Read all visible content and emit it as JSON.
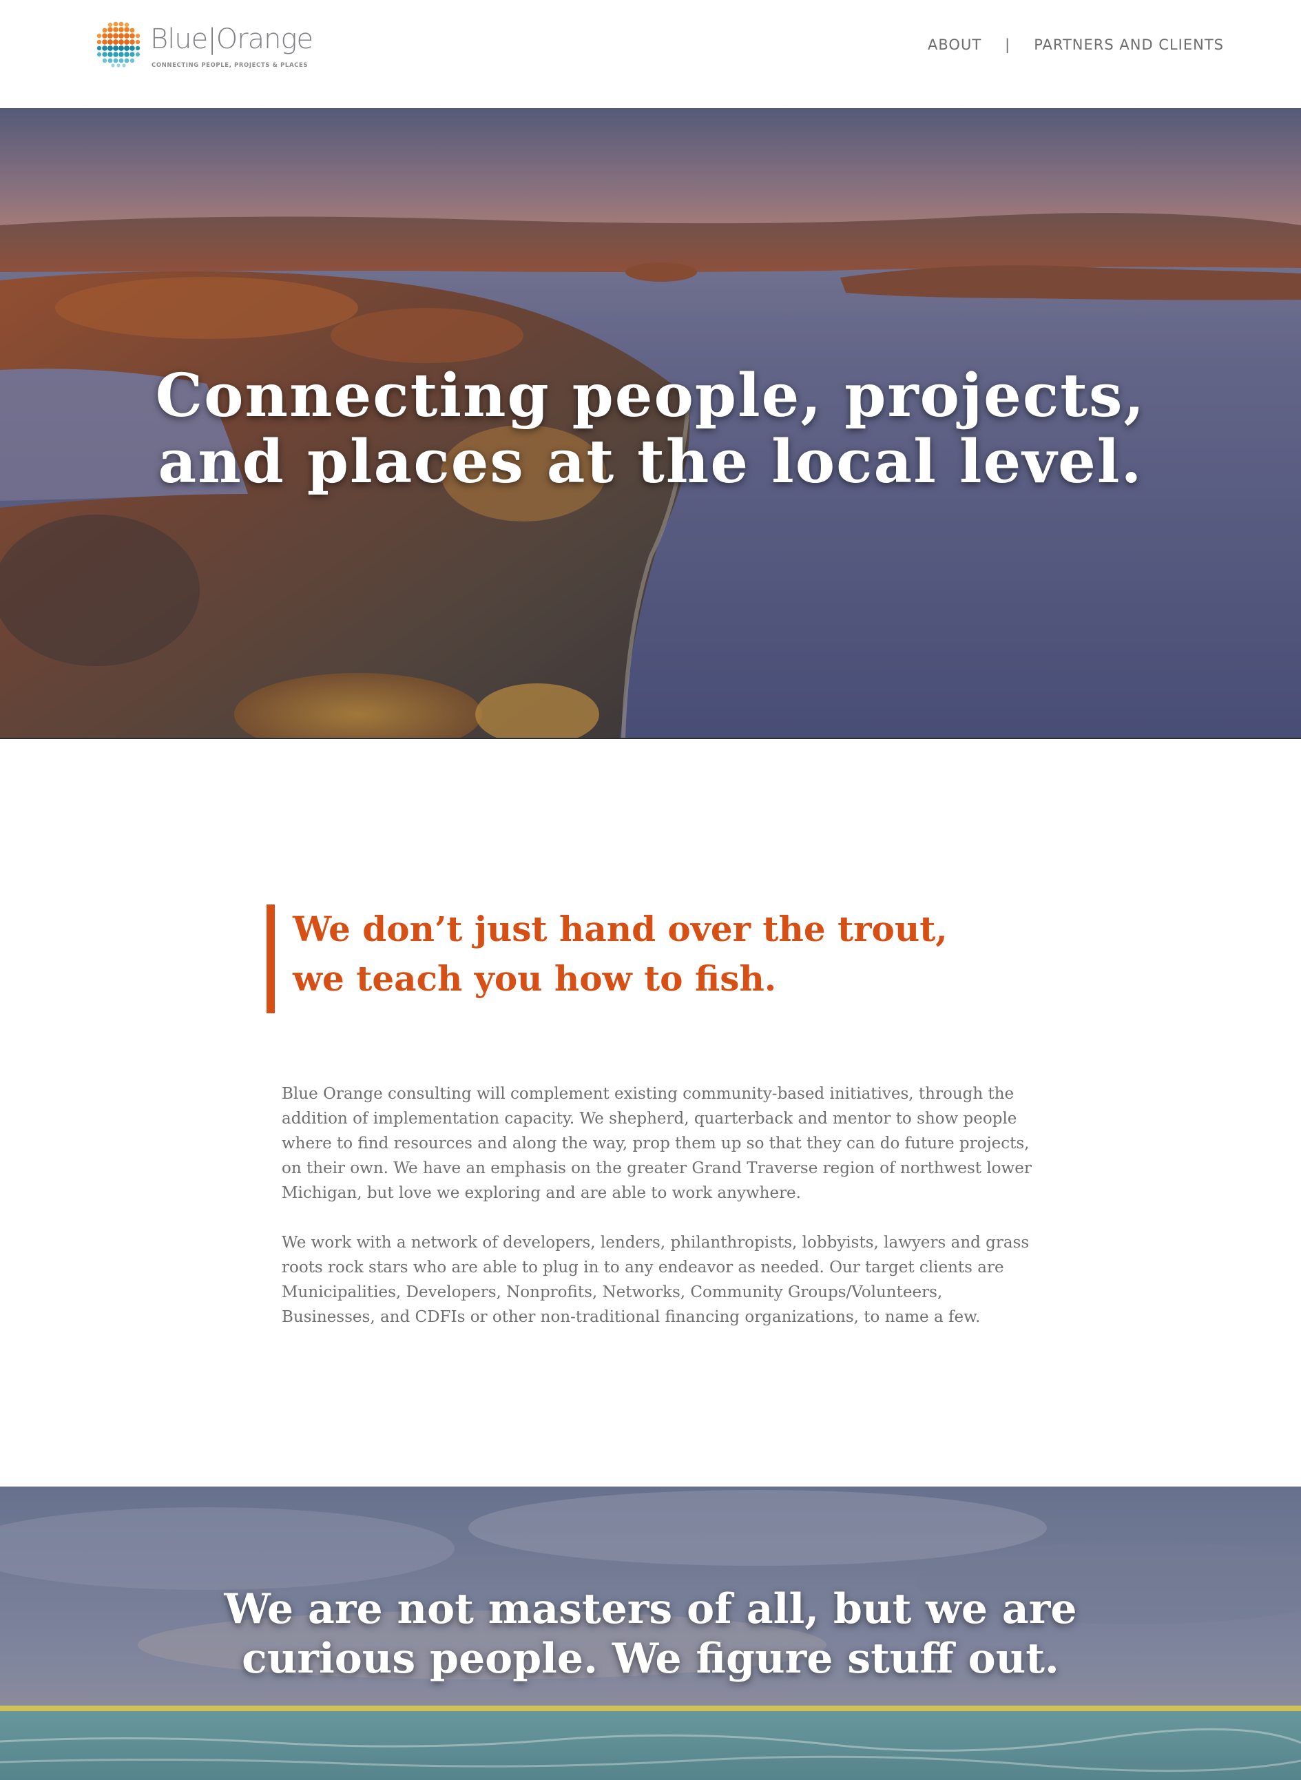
{
  "header": {
    "logo": {
      "name": "Blue|Orange",
      "tagline": "CONNECTING PEOPLE, PROJECTS & PLACES"
    },
    "nav": {
      "items": [
        {
          "label": "ABOUT"
        },
        {
          "label": "PARTNERS AND CLIENTS"
        }
      ],
      "separator": "|"
    }
  },
  "hero": {
    "title": "Connecting people, projects,\nand places at the local level."
  },
  "main": {
    "quote": "We don’t just hand over the trout, we teach you how to fish.",
    "paragraphs": [
      "Blue Orange consulting will complement existing community-based initiatives, through the addition of implementation capacity. We shepherd, quarterback and mentor to show people where to find resources and along the way, prop them up so that they can do future projects, on their own. We have an emphasis on the greater Grand Traverse region of northwest lower Michigan, but love we exploring and are able to work anywhere.",
      "We work with a network of developers, lenders, philanthropists, lobbyists, lawyers and grass roots rock stars who are able to plug in to any endeavor as needed. Our target clients are Municipalities, Developers, Nonprofits, Networks, Community Groups/Volunteers, Businesses, and CDFIs or other non-traditional financing organizations, to name a few."
    ]
  },
  "band": {
    "title": "We are not masters of all, but we are\ncurious people. We figure stuff out."
  },
  "colors": {
    "accent": "#d84f16",
    "logo_orange": "#f0862c",
    "logo_teal": "#2aa3b8",
    "text_gray": "#707070"
  }
}
